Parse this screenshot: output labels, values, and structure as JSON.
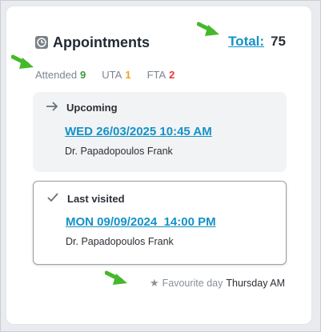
{
  "header": {
    "title": "Appointments",
    "icon": "clock-icon",
    "total_label": "Total:",
    "total_value": "75"
  },
  "stats": [
    {
      "label": "Attended",
      "value": "9",
      "color": "#3a9b3f"
    },
    {
      "label": "UTA",
      "value": "1",
      "color": "#f0a020"
    },
    {
      "label": "FTA",
      "value": "2",
      "color": "#e53935"
    }
  ],
  "upcoming": {
    "icon": "arrow-right-icon",
    "label": "Upcoming",
    "date": "WED 26/03/2025 10:45 AM",
    "doctor": "Dr. Papadopoulos Frank"
  },
  "last_visited": {
    "icon": "check-icon",
    "label": "Last visited",
    "date": "MON 09/09/2024  14:00 PM",
    "doctor": "Dr. Papadopoulos Frank"
  },
  "favourite": {
    "icon": "star-icon",
    "label": "Favourite day",
    "value": "Thursday AM"
  },
  "colors": {
    "link": "#1591c8",
    "annotation_arrow": "#46b82c"
  }
}
